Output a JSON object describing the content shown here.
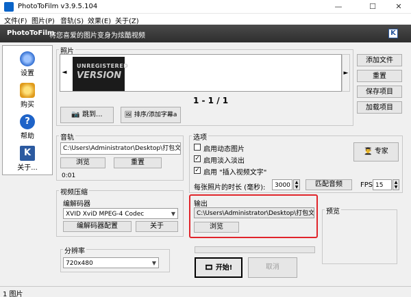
{
  "window": {
    "title": "PhotoToFilm v3.9.5.104",
    "minimize": "—",
    "maximize": "☐",
    "close": "✕"
  },
  "menu": [
    {
      "label": "文件(F)"
    },
    {
      "label": "图片(P)"
    },
    {
      "label": "音轨(S)"
    },
    {
      "label": "效果(E)"
    },
    {
      "label": "关于(Z)"
    }
  ],
  "banner": {
    "brand": "PhotoToFilm",
    "tagline": "将您喜爱的图片变身为炫酷视频",
    "logo": "K"
  },
  "sidebar": [
    {
      "label": "设置",
      "icon": "gear-icon"
    },
    {
      "label": "购买",
      "icon": "star-hand-icon"
    },
    {
      "label": "帮助",
      "icon": "help-icon"
    },
    {
      "label": "关于...",
      "icon": "k-logo-icon"
    }
  ],
  "photos": {
    "label": "照片",
    "thumb_line1": "UNREGISTERED",
    "thumb_line2": "VERSION",
    "prev": "◄",
    "next": "►",
    "counter": "1 - 1 / 1",
    "goto_label": "跳到...",
    "sort_label": "排序/添加字幕a"
  },
  "right_buttons": {
    "add_file": "添加文件",
    "reset": "重置",
    "save_project": "保存项目",
    "load_project": "加载项目"
  },
  "audio": {
    "label": "音轨",
    "path": "C:\\Users\\Administrator\\Desktop\\打包文件\\pdf",
    "browse": "浏览",
    "reset": "重置",
    "duration": "0:01"
  },
  "video_compression": {
    "label": "视频压缩",
    "encoder_label": "编解码器",
    "encoder_value": "XVID XviD MPEG-4 Codec",
    "config_button": "编解码器配置",
    "about_button": "关于"
  },
  "resolution": {
    "label": "分辨率",
    "value": "720x480"
  },
  "options": {
    "label": "选项",
    "animate_label": "启用动态图片",
    "animate_checked": false,
    "fade_label": "启用淡入淡出",
    "fade_checked": true,
    "insert_text_label": "启用 \"插入视频文字\"",
    "insert_text_checked": true,
    "expert_label": "专家",
    "duration_label": "每张照片的时长 (毫秒):",
    "duration_value": "3000",
    "match_audio": "匹配音频",
    "fps_label": "FPS",
    "fps_value": "15"
  },
  "output": {
    "label": "输出",
    "path": "C:\\Users\\Administrator\\Desktop\\打包文件\\pdf",
    "browse": "浏览"
  },
  "preview": {
    "label": "预览"
  },
  "actions": {
    "start": "开始!",
    "cancel": "取消"
  },
  "status": {
    "text": "1 图片"
  }
}
